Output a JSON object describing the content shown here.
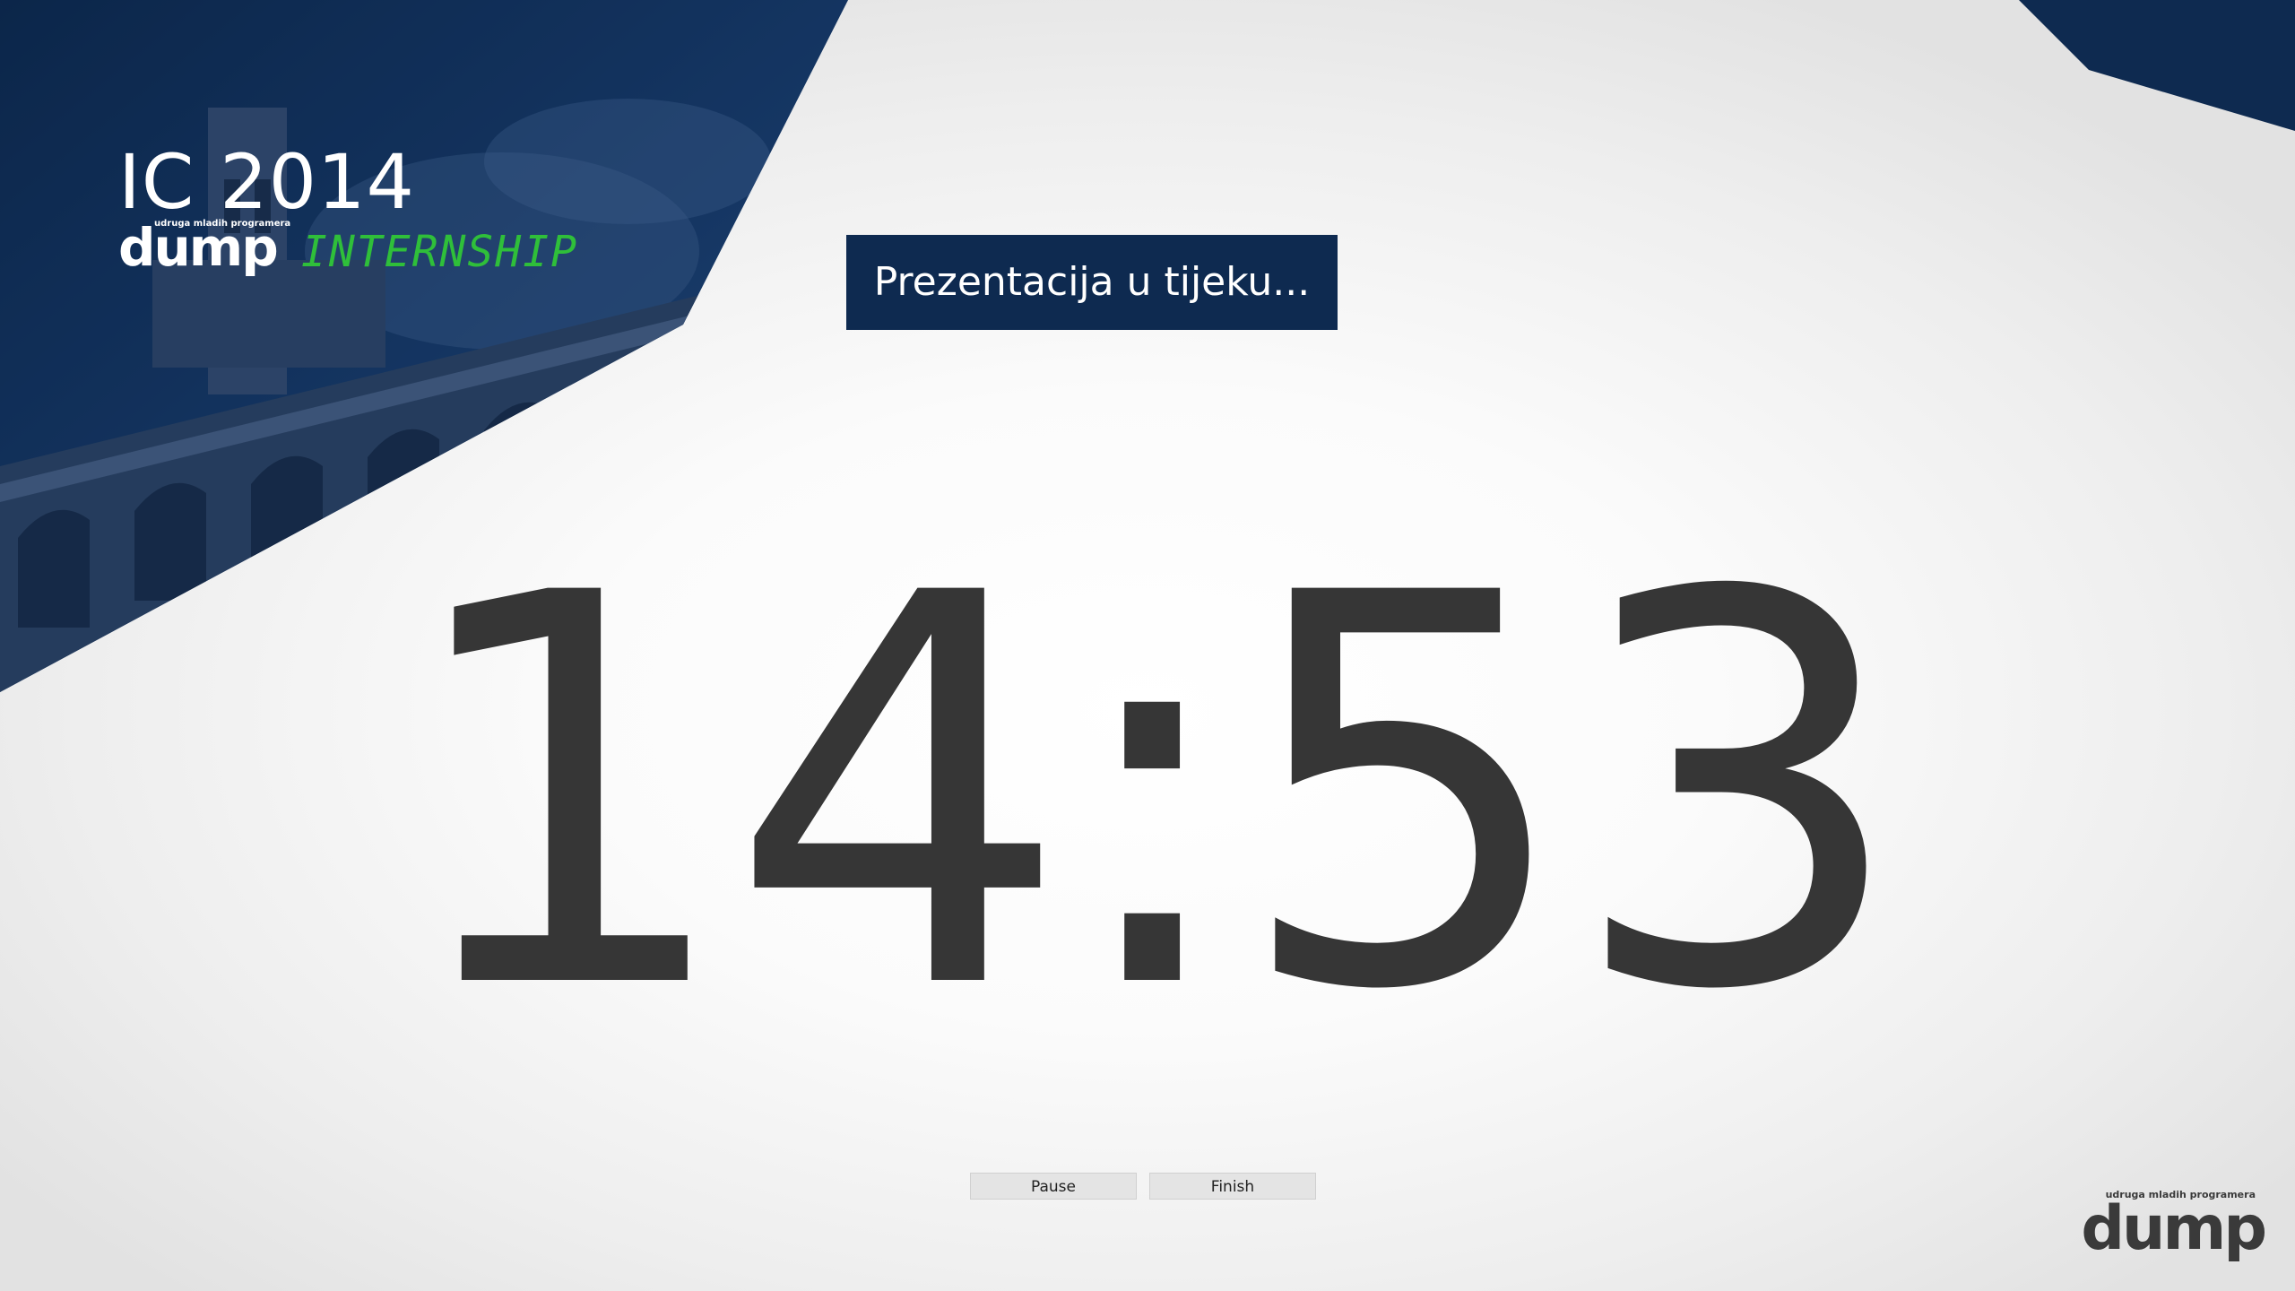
{
  "header": {
    "event_title": "IC 2014",
    "org_tagline": "udruga mladih programera",
    "org_name": "dump",
    "program_name": "INTERNSHIP"
  },
  "status": {
    "label": "Prezentacija u tijeku..."
  },
  "timer": {
    "display": "14:53"
  },
  "controls": {
    "pause_label": "Pause",
    "finish_label": "Finish"
  },
  "footer": {
    "org_tagline": "udruga mladih programera",
    "org_name": "dump"
  },
  "colors": {
    "navy": "#0e2a50",
    "accent_green": "#2fbf3a",
    "timer_text": "#363636"
  }
}
